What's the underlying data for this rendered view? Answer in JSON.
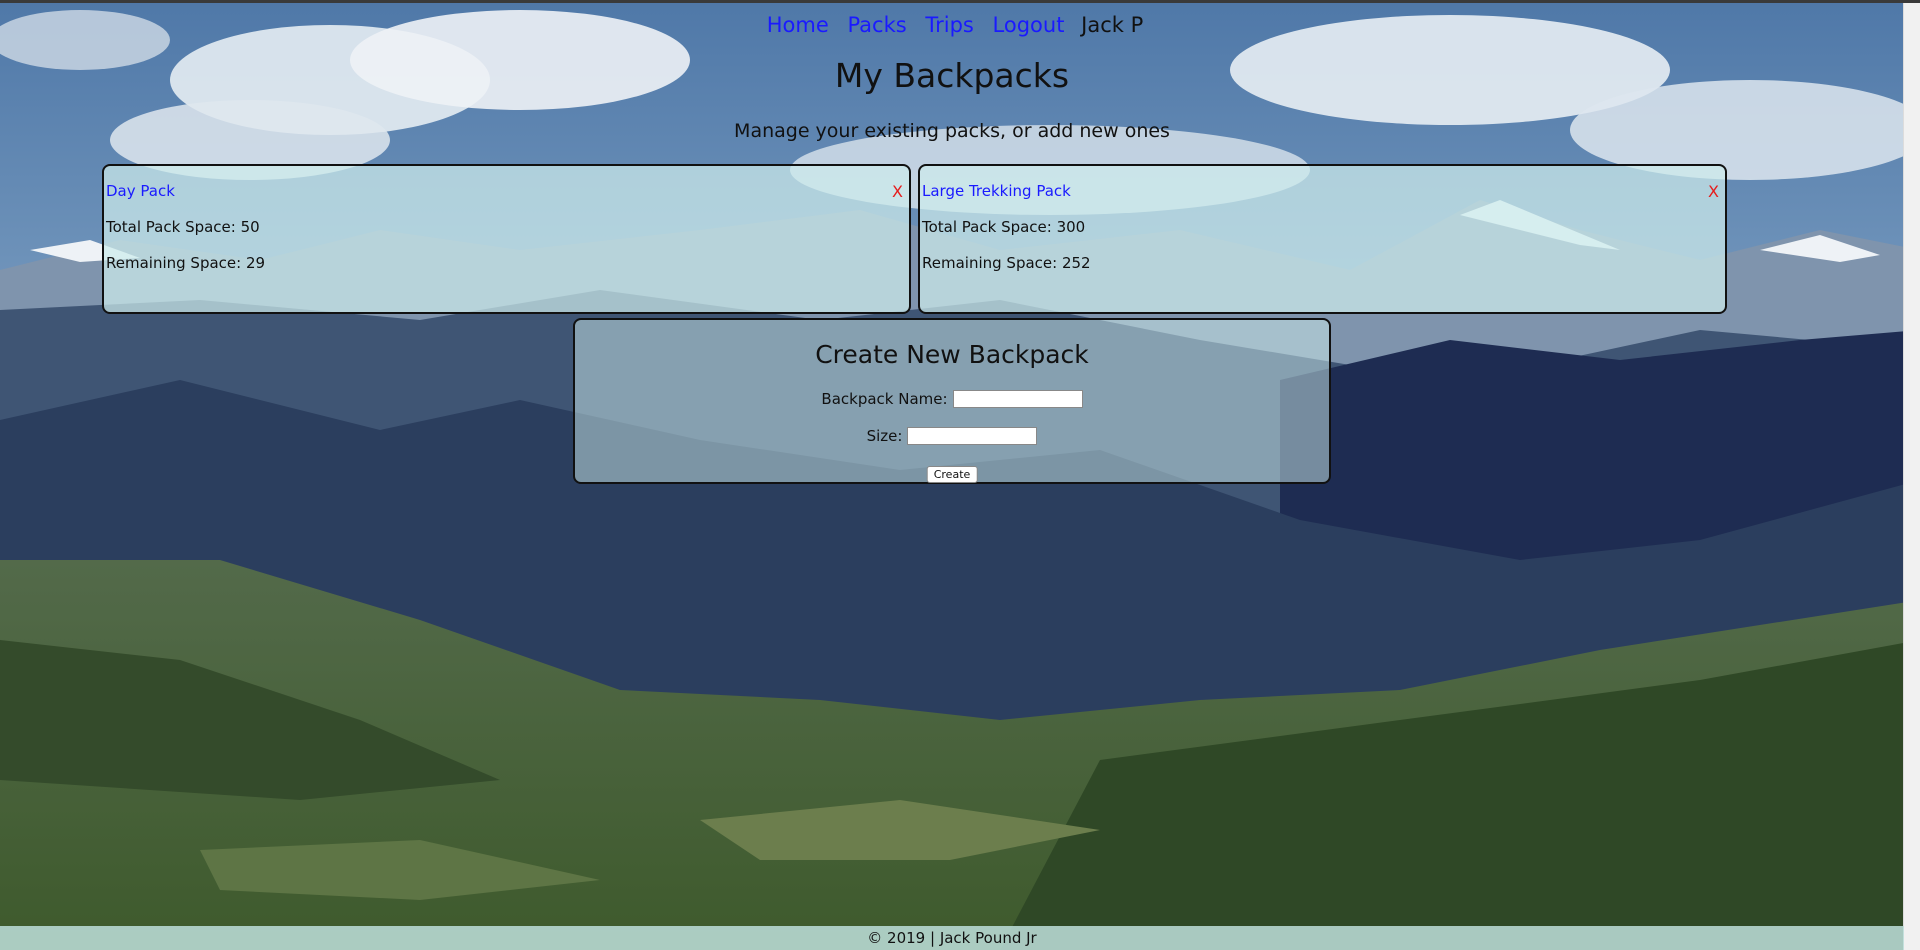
{
  "nav": {
    "links": [
      "Home",
      "Packs",
      "Trips",
      "Logout"
    ],
    "user": "Jack P"
  },
  "header": {
    "title": "My Backpacks",
    "subtitle": "Manage your existing packs, or add new ones"
  },
  "packs": [
    {
      "name": "Day Pack",
      "total_label": "Total Pack Space: 50",
      "remaining_label": "Remaining Space: 29",
      "delete": "X"
    },
    {
      "name": "Large Trekking Pack",
      "total_label": "Total Pack Space: 300",
      "remaining_label": "Remaining Space: 252",
      "delete": "X"
    }
  ],
  "create_form": {
    "title": "Create New Backpack",
    "name_label": "Backpack Name:",
    "name_value": "",
    "size_label": "Size:",
    "size_value": "",
    "submit_label": "Create"
  },
  "footer": {
    "text": "© 2019 | Jack Pound Jr"
  },
  "colors": {
    "link": "#1a1aff",
    "delete": "#e61c1c",
    "card_bg": "#cdecec"
  }
}
